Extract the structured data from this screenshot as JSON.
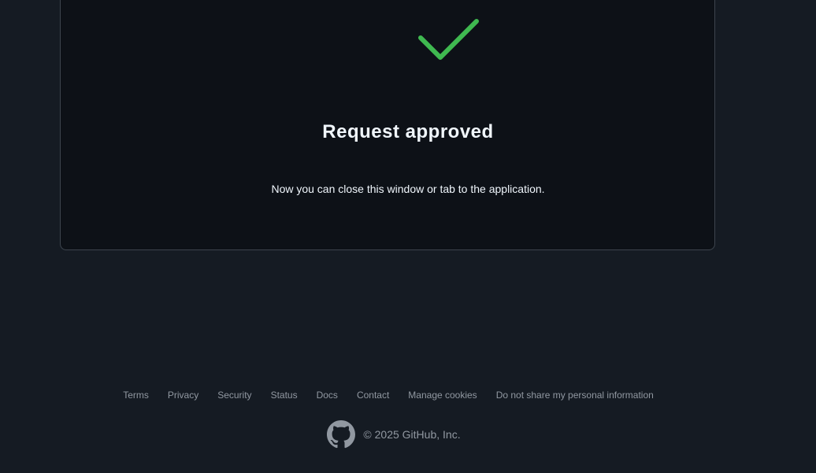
{
  "card": {
    "title": "Request approved",
    "message": "Now you can close this window or tab to the application."
  },
  "icons": {
    "status": "check-icon",
    "brand": "github-icon"
  },
  "colors": {
    "success": "#3fb950",
    "background": "#151b23",
    "card": "#0d1117",
    "border": "#3d444d",
    "muted_text": "#9198a1",
    "heading_text": "#f0f6fc"
  },
  "footer": {
    "links": [
      "Terms",
      "Privacy",
      "Security",
      "Status",
      "Docs",
      "Contact",
      "Manage cookies",
      "Do not share my personal information"
    ],
    "copyright": "© 2025 GitHub, Inc."
  }
}
